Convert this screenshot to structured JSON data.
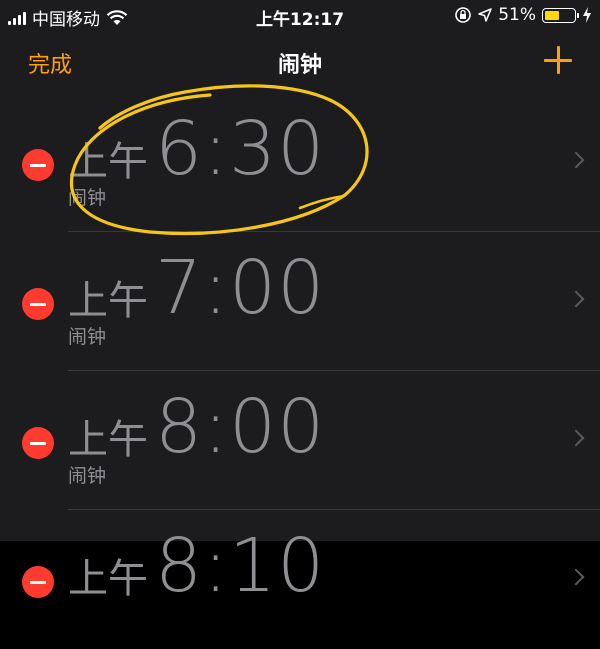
{
  "status_bar": {
    "carrier": "中国移动",
    "time": "上午12:17",
    "battery_percent": "51%",
    "battery_level": 0.51,
    "icons": [
      "signal-icon",
      "wifi-icon",
      "rotation-lock-icon",
      "location-icon",
      "battery-icon",
      "charging-icon"
    ]
  },
  "nav": {
    "done_label": "完成",
    "title": "闹钟",
    "add_icon": "plus-icon"
  },
  "alarms": [
    {
      "period": "上午",
      "time": "6:30",
      "label": "闹钟"
    },
    {
      "period": "上午",
      "time": "7:00",
      "label": "闹钟"
    },
    {
      "period": "上午",
      "time": "8:00",
      "label": "闹钟"
    },
    {
      "period": "上午",
      "time": "8:10",
      "label": ""
    }
  ],
  "colors": {
    "accent": "#ff9f0a",
    "delete": "#ff3b30",
    "annotation": "#f5c518",
    "battery_fill": "#ffd60a"
  }
}
